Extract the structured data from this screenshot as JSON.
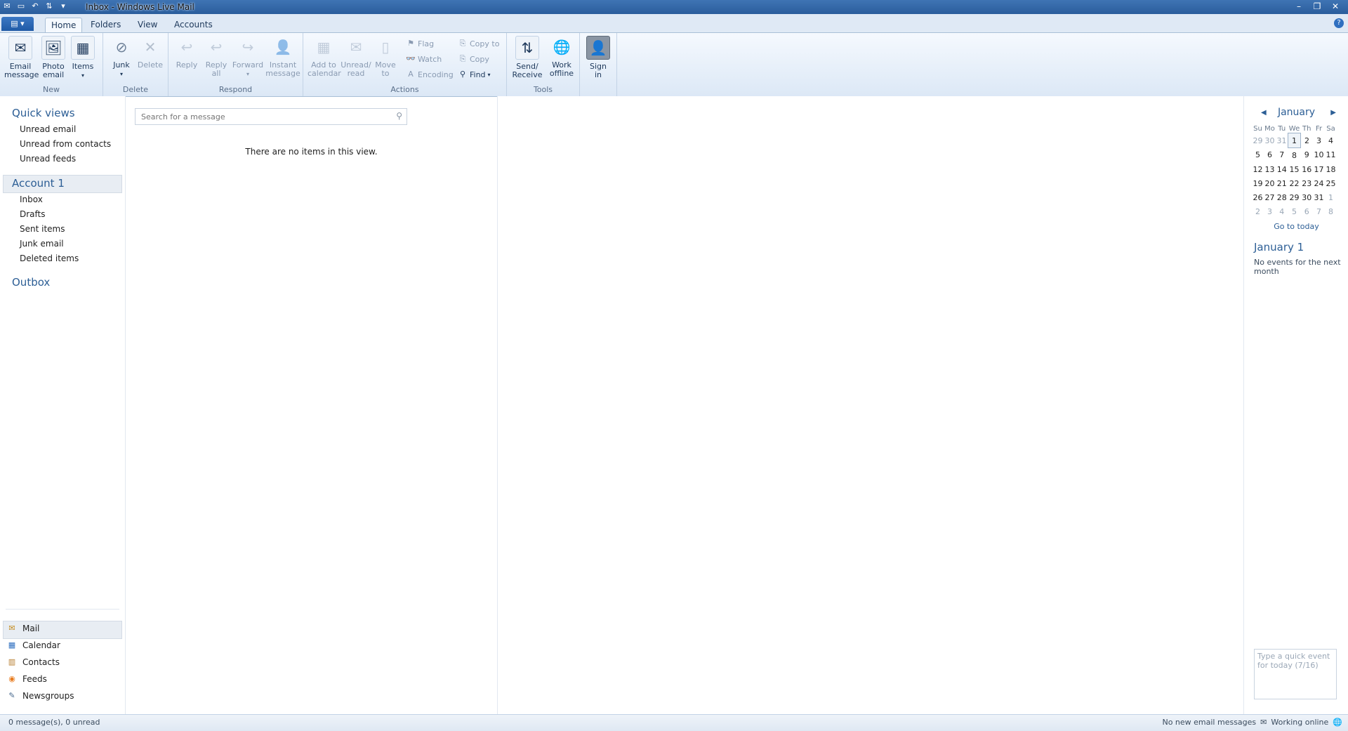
{
  "window": {
    "title": "Inbox - Windows Live Mail"
  },
  "tabs": [
    {
      "label": "Home",
      "active": true
    },
    {
      "label": "Folders"
    },
    {
      "label": "View"
    },
    {
      "label": "Accounts"
    }
  ],
  "ribbon": {
    "groups": {
      "new": "New",
      "delete": "Delete",
      "respond": "Respond",
      "actions": "Actions",
      "tools": "Tools"
    },
    "buttons": {
      "email_message": "Email\nmessage",
      "photo_email": "Photo\nemail",
      "items": "Items",
      "junk": "Junk",
      "delete": "Delete",
      "reply": "Reply",
      "reply_all": "Reply\nall",
      "forward": "Forward",
      "instant_message": "Instant\nmessage",
      "add_to_calendar": "Add to\ncalendar",
      "unread_read": "Unread/\nread",
      "move_to": "Move\nto",
      "flag": "Flag",
      "watch": "Watch",
      "encoding": "Encoding",
      "copy_to": "Copy to",
      "copy": "Copy",
      "find": "Find",
      "send_receive": "Send/\nReceive",
      "work_offline": "Work\noffline",
      "sign_in": "Sign\nin"
    }
  },
  "nav": {
    "quick_views": "Quick views",
    "quick_items": [
      "Unread email",
      "Unread from contacts",
      "Unread feeds"
    ],
    "account": "Account 1",
    "folders": [
      "Inbox",
      "Drafts",
      "Sent items",
      "Junk email",
      "Deleted items"
    ],
    "outbox": "Outbox",
    "modes": [
      "Mail",
      "Calendar",
      "Contacts",
      "Feeds",
      "Newsgroups"
    ]
  },
  "message_list": {
    "search_placeholder": "Search for a message",
    "empty_text": "There are no items in this view."
  },
  "calendar": {
    "month": "January",
    "weekdays": [
      "Su",
      "Mo",
      "Tu",
      "We",
      "Th",
      "Fr",
      "Sa"
    ],
    "weeks": [
      [
        "29",
        "30",
        "31",
        "1",
        "2",
        "3",
        "4"
      ],
      [
        "5",
        "6",
        "7",
        "8",
        "9",
        "10",
        "11"
      ],
      [
        "12",
        "13",
        "14",
        "15",
        "16",
        "17",
        "18"
      ],
      [
        "19",
        "20",
        "21",
        "22",
        "23",
        "24",
        "25"
      ],
      [
        "26",
        "27",
        "28",
        "29",
        "30",
        "31",
        "1"
      ],
      [
        "2",
        "3",
        "4",
        "5",
        "6",
        "7",
        "8"
      ]
    ],
    "go_to_today": "Go to today",
    "day_title": "January 1",
    "no_events": "No events for the next month",
    "quick_event_placeholder": "Type a quick event for today (7/16)"
  },
  "status": {
    "left": "0 message(s), 0 unread",
    "right_1": "No new email messages",
    "right_2": "Working online"
  },
  "colors": {
    "accent": "#2c5e95",
    "ribbon_bg": "#dce8f6",
    "titlebar": "#3f74b4"
  }
}
